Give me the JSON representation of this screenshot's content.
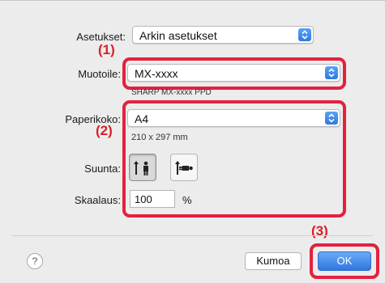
{
  "settings": {
    "label": "Asetukset:",
    "value": "Arkin asetukset"
  },
  "format": {
    "label": "Muotoile:",
    "value": "MX-xxxx",
    "subtitle": "SHARP MX-xxxx PPD"
  },
  "paper": {
    "label": "Paperikoko:",
    "value": "A4",
    "dimensions": "210 x 297 mm"
  },
  "orientation": {
    "label": "Suunta:",
    "selected": "portrait"
  },
  "scale": {
    "label": "Skaalaus:",
    "value": "100",
    "unit": "%"
  },
  "steps": {
    "step1": "(1)",
    "step2": "(2)",
    "step3": "(3)"
  },
  "buttons": {
    "help": "?",
    "cancel": "Kumoa",
    "ok": "OK"
  },
  "colors": {
    "highlight": "#e3213f",
    "step_text": "#d92027",
    "accent": "#2f78e2"
  }
}
